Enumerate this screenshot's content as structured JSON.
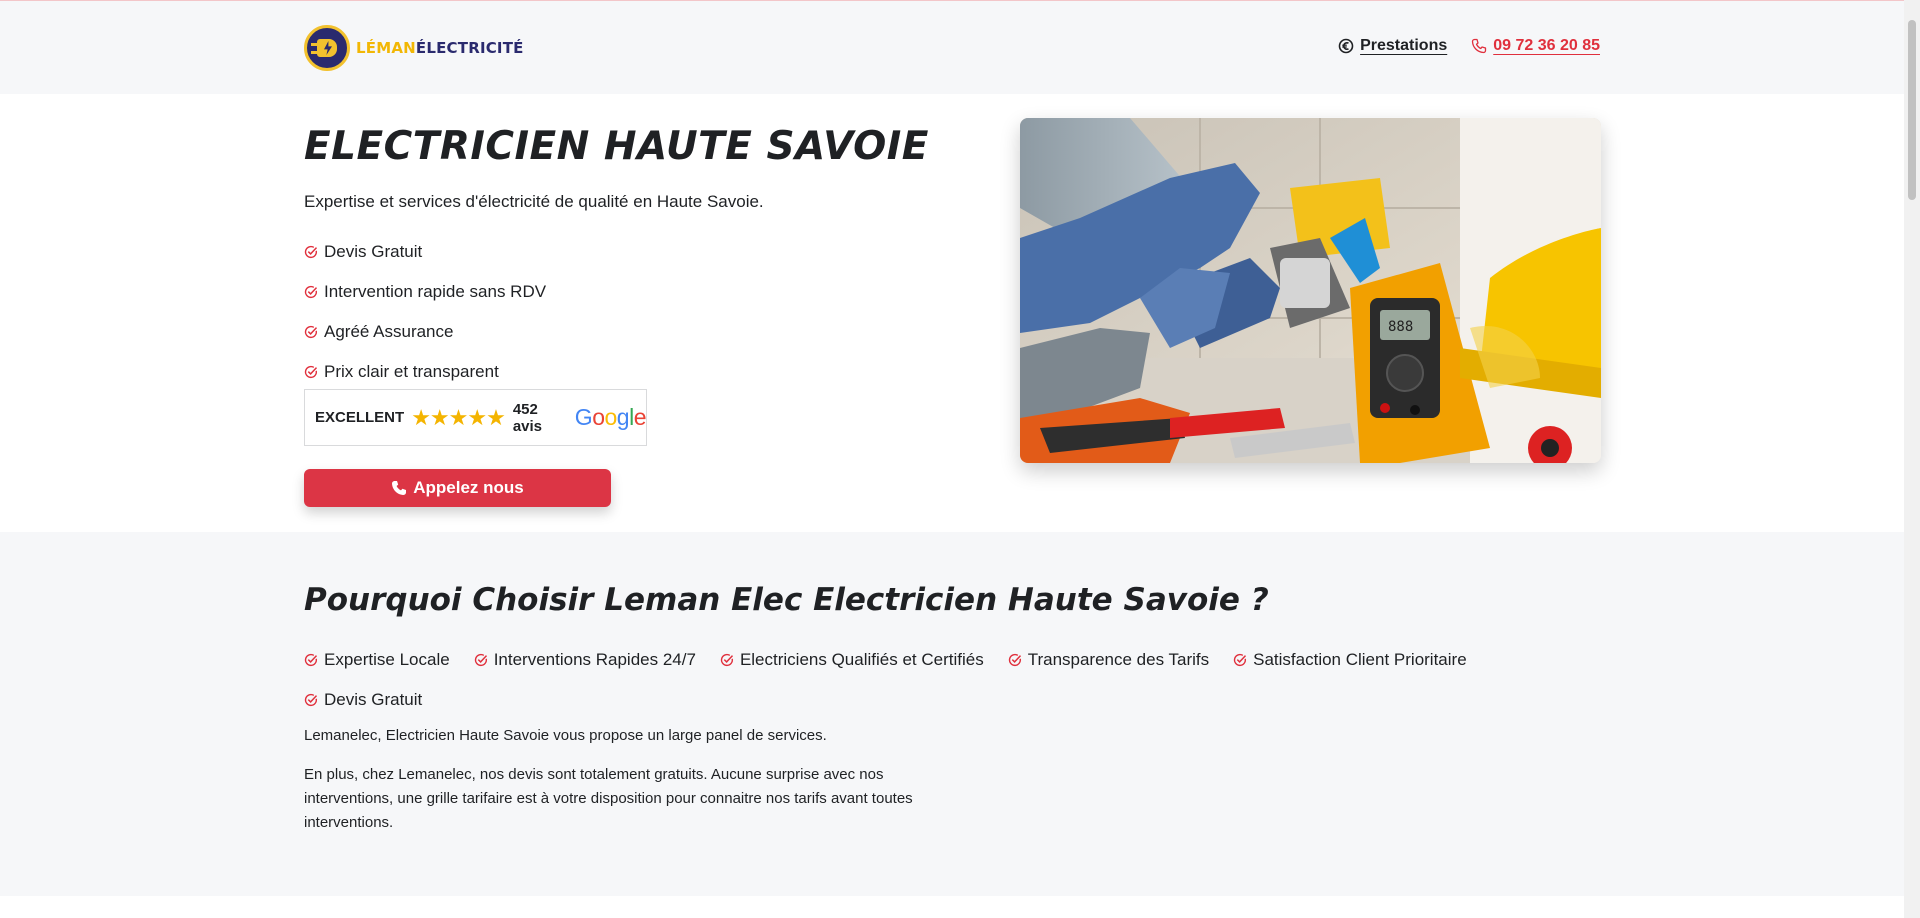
{
  "header": {
    "logo_part1": "LÉMAN",
    "logo_part2": "ÉLECTRICITÉ",
    "nav": {
      "prestations": "Prestations",
      "phone": "09 72 36 20 85"
    }
  },
  "hero": {
    "title": "ELECTRICIEN HAUTE SAVOIE",
    "subtitle": "Expertise et services d'électricité de qualité en Haute Savoie.",
    "checks": [
      "Devis Gratuit",
      "Intervention rapide sans RDV",
      "Agréé Assurance",
      "Prix clair et transparent"
    ],
    "review": {
      "label": "EXCELLENT",
      "stars": "★★★★★",
      "count": "452 avis",
      "rating_stars": 5
    },
    "cta_label": "Appelez nous",
    "image_alt": "electrician-working-on-socket-with-multimeter"
  },
  "why": {
    "title": "Pourquoi Choisir Leman Elec Electricien Haute Savoie ?",
    "checks": [
      "Expertise Locale",
      "Interventions Rapides 24/7",
      "Electriciens Qualifiés et Certifiés",
      "Transparence des Tarifs",
      "Satisfaction Client Prioritaire",
      "Devis Gratuit"
    ],
    "paragraph1": "Lemanelec, Electricien Haute Savoie vous propose un large panel de services.",
    "paragraph2": "En plus, chez Lemanelec, nos devis sont totalement gratuits. Aucune surprise avec nos interventions, une grille tarifaire est à votre disposition pour connaitre nos tarifs avant toutes interventions."
  },
  "colors": {
    "accent_red": "#dc3545",
    "phone_red": "#e0303d",
    "logo_navy": "#2a2a6e",
    "logo_yellow": "#f2b705"
  },
  "icons": [
    "plug-logo-icon",
    "euro-icon",
    "phone-icon",
    "check-circle-icon",
    "phone-handset-icon",
    "google-logo"
  ]
}
